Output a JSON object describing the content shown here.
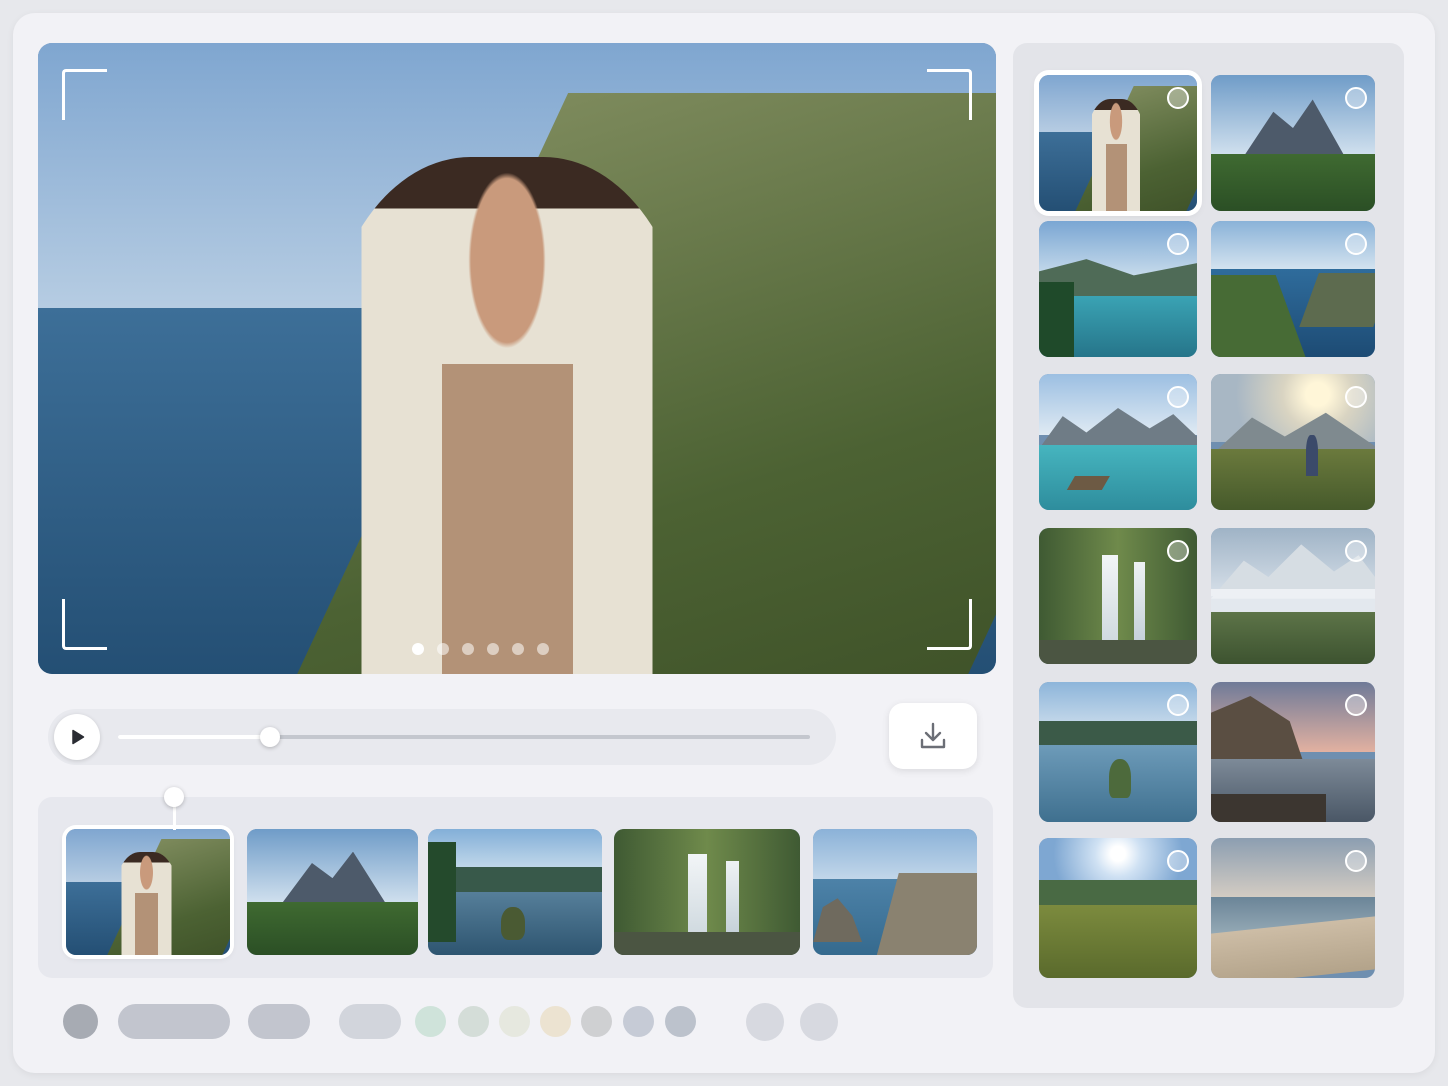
{
  "hero": {
    "slide_count": 6,
    "active_slide": 1
  },
  "player": {
    "progress": 0.22
  },
  "filmstrip": {
    "selected": 1,
    "items": [
      "coast-portrait",
      "mountain-peaks",
      "lake-canoe",
      "waterfall",
      "coastal-cliffs"
    ]
  },
  "gallery": {
    "selected": 1,
    "items": [
      "coast-portrait",
      "mountain-peaks",
      "alpine-lake",
      "fjord-bay",
      "lake-dock",
      "sunrise-trail",
      "twin-waterfall",
      "misty-valley",
      "lake-kayak",
      "rocky-shore-sunset",
      "sunlit-meadow",
      "sandy-beach"
    ]
  },
  "palette": {
    "colors": [
      "#a7abb3",
      "#c2c5ce",
      "#c2c5ce",
      "#d2d5dc",
      "#cfe3da",
      "#d4ddd8",
      "#e6e8df",
      "#ece3d1",
      "#cfd0d2",
      "#c6cbd6",
      "#bcc2cc",
      "#d7d9e0",
      "#d7d9e0"
    ]
  },
  "icons": {
    "play": "play-icon",
    "download": "download-icon",
    "select": "select-circle-icon"
  },
  "colors": {
    "background": "#f2f2f6",
    "panel": "#e3e4e9",
    "accent": "#ffffff"
  }
}
